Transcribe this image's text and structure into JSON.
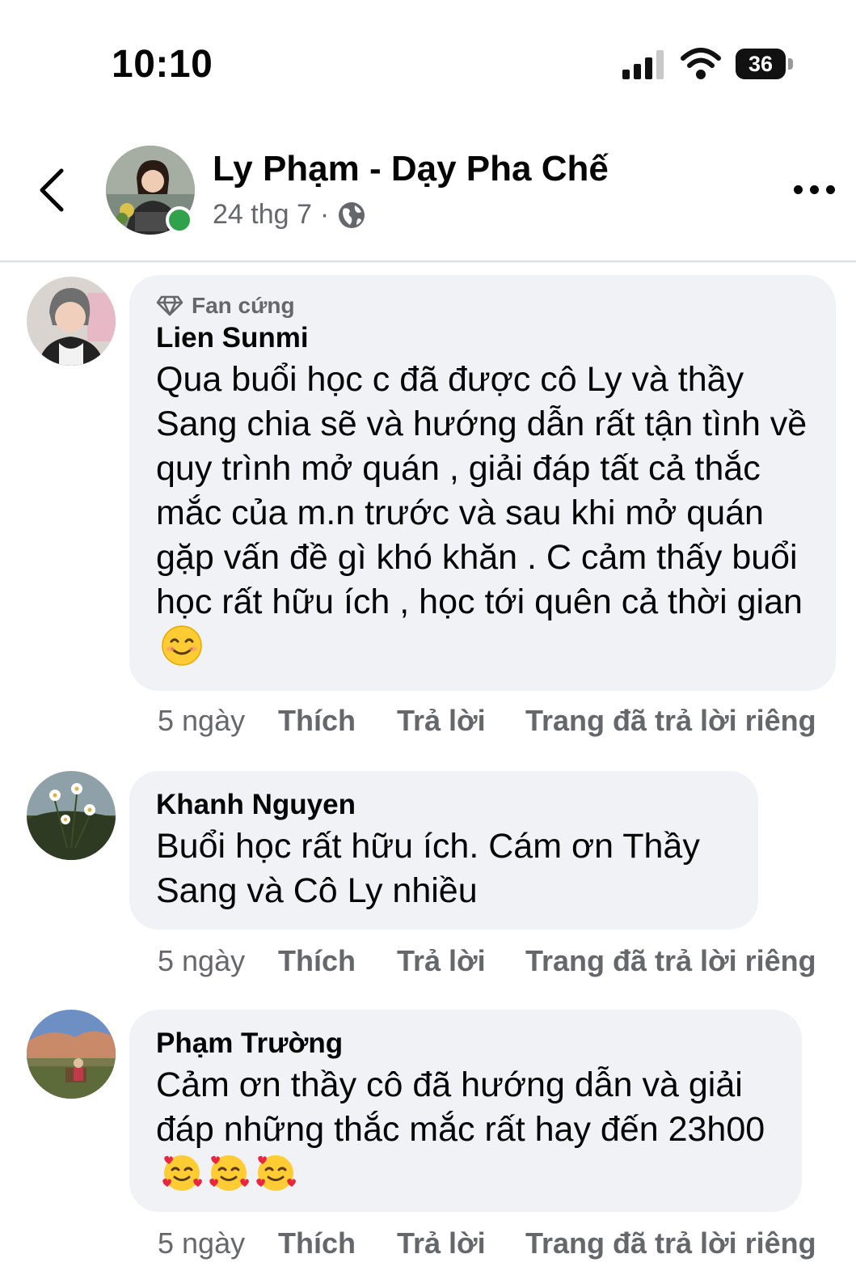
{
  "status_bar": {
    "time": "10:10",
    "battery": "36"
  },
  "header": {
    "page_name": "Ly Phạm - Dạy Pha Chế",
    "date": "24 thg 7",
    "separator": "·",
    "icons": {
      "back": "back-chevron-icon",
      "privacy": "globe-icon",
      "more": "more-dots-icon"
    },
    "online_color": "#31a24c"
  },
  "comments": [
    {
      "badge": "Fan cứng",
      "author": "Lien Sunmi",
      "text": "Qua buổi học c đã được cô Ly và thầy Sang chia sẽ và hướng dẫn rất tận tình về quy trình mở quán , giải đáp tất cả thắc mắc của m.n trước và sau khi mở quán gặp vấn đề gì khó khăn . C cảm thấy buổi học rất hữu ích , học tới quên cả thời gian",
      "emoji": "smiling-face-emoji",
      "time": "5 ngày",
      "like": "Thích",
      "reply": "Trả lời",
      "private_reply": "Trang đã trả lời riêng"
    },
    {
      "author": "Khanh Nguyen",
      "text": "Buổi học rất hữu ích. Cám ơn Thầy Sang và Cô Ly nhiều",
      "time": "5 ngày",
      "like": "Thích",
      "reply": "Trả lời",
      "private_reply": "Trang đã trả lời riêng"
    },
    {
      "author": "Phạm Trường",
      "text": "Cảm ơn thầy cô đã hướng dẫn và giải đáp những thắc mắc rất hay đến 23h00",
      "emoji": "smiling-face-with-hearts-emoji x3",
      "time": "5 ngày",
      "like": "Thích",
      "reply": "Trả lời",
      "private_reply": "Trang đã trả lời riêng"
    }
  ]
}
